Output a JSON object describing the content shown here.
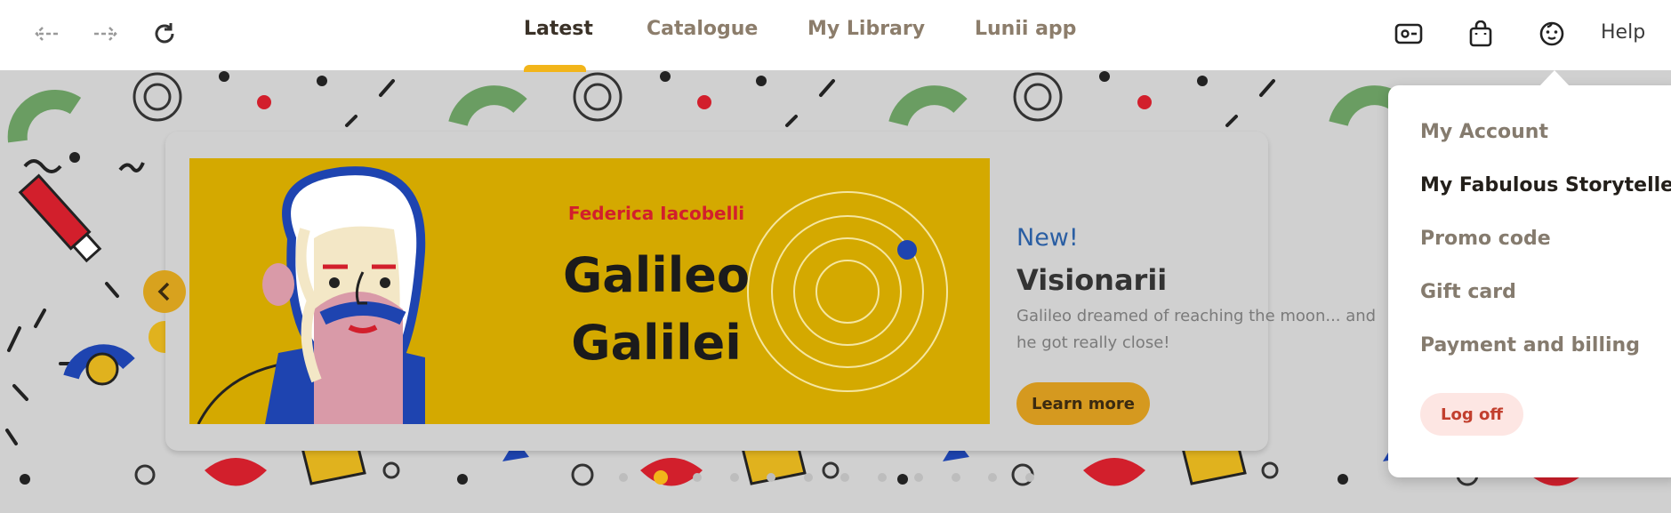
{
  "nav": {
    "back_icon": "arrow-left-icon",
    "forward_icon": "arrow-right-icon",
    "reload_icon": "reload-icon"
  },
  "tabs": [
    {
      "label": "Latest",
      "active": true
    },
    {
      "label": "Catalogue",
      "active": false
    },
    {
      "label": "My Library",
      "active": false
    },
    {
      "label": "Lunii app",
      "active": false
    }
  ],
  "header_icons": [
    "ticket-icon",
    "shopping-bag-icon",
    "account-face-icon"
  ],
  "help_label": "Help",
  "banner": {
    "author": "Federica Iacobelli",
    "title_line1": "Galileo",
    "title_line2": "Galilei"
  },
  "promo": {
    "badge": "New!",
    "title": "Visionarii",
    "description": "Galileo dreamed of reaching the moon... and he got really close!",
    "cta_label": "Learn more"
  },
  "carousel": {
    "page_count": 12,
    "active_index": 1
  },
  "account_menu": {
    "items": [
      "My Account",
      "My Fabulous Storytellers",
      "Promo code",
      "Gift card",
      "Payment and billing"
    ],
    "highlighted_index": 1,
    "logoff_label": "Log off"
  },
  "colors": {
    "accent_yellow": "#f2b51a",
    "banner_yellow": "#d4a900",
    "logoff_red": "#c23f2e",
    "new_blue": "#2a5ea3"
  }
}
